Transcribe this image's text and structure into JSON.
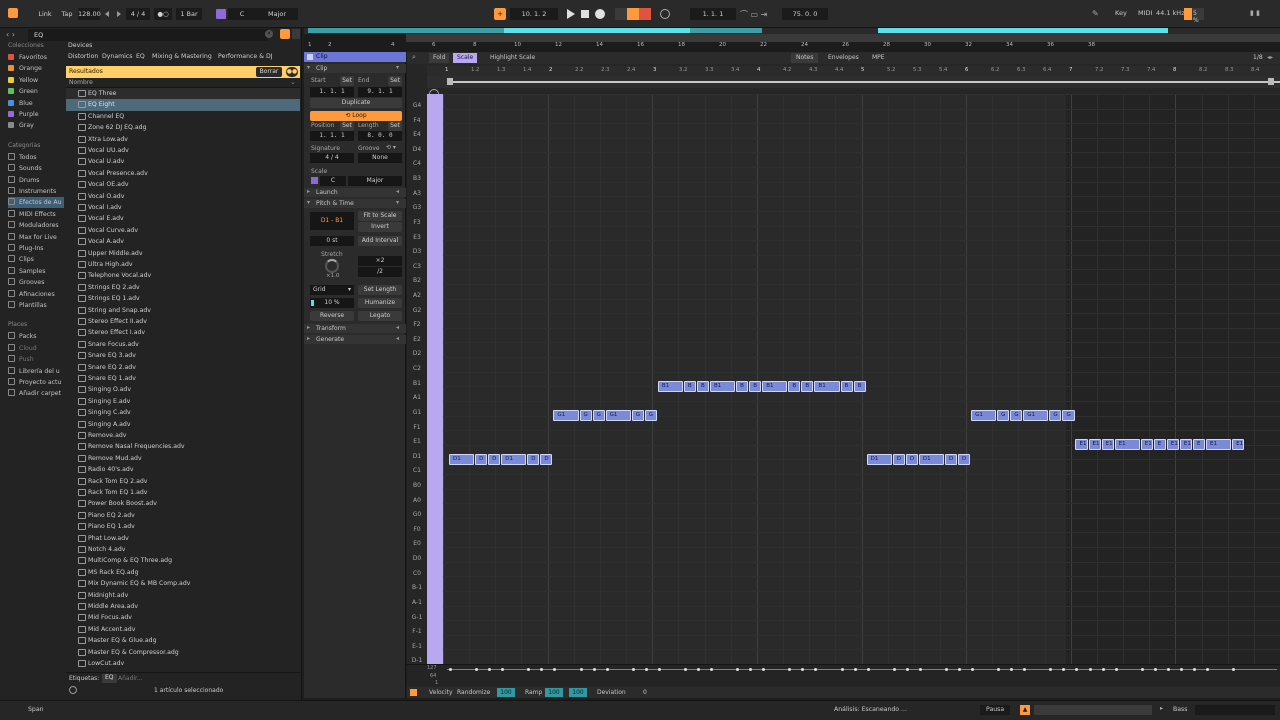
{
  "transport": {
    "link": "Link",
    "tap": "Tap",
    "tempo": "128.00",
    "sig_num": "4",
    "sig_den": "4",
    "quant": "1 Bar",
    "key": "C",
    "scale": "Major",
    "position": "10.  1.  2",
    "loop_start": "1.  1.  1",
    "loop_len": "75.  0.  0",
    "key_label": "Key",
    "midi_label": "MIDI",
    "sample_rate": "44.1 kHz",
    "cpu": "5 %"
  },
  "browser": {
    "search_value": "EQ",
    "collections_header": "Colecciones",
    "collections": [
      {
        "label": "Favoritos",
        "color": "#e0533f"
      },
      {
        "label": "Orange",
        "color": "#e8923a"
      },
      {
        "label": "Yellow",
        "color": "#e6d03a"
      },
      {
        "label": "Green",
        "color": "#5cc05c"
      },
      {
        "label": "Blue",
        "color": "#4a8fe0"
      },
      {
        "label": "Purple",
        "color": "#9a6ad6"
      },
      {
        "label": "Gray",
        "color": "#8a8a8a"
      }
    ],
    "categories_header": "Categorías",
    "categories": [
      "Todos",
      "Sounds",
      "Drums",
      "Instruments",
      "Efectos de Au",
      "MIDI Effects",
      "Moduladores",
      "Max for Live",
      "Plug-Ins",
      "Clips",
      "Samples",
      "Grooves",
      "Afinaciones",
      "Plantillas"
    ],
    "places_header": "Places",
    "places": [
      "Packs",
      "Cloud",
      "Push",
      "Librería del u",
      "Proyecto actu",
      "Añadir carpet"
    ],
    "filter_tabs": [
      "Devices",
      "Distortion",
      "Dynamics",
      "EQ",
      "Mixing & Mastering",
      "Performance & DJ"
    ],
    "results_label": "Resultados",
    "clear_label": "Borrar",
    "name_header": "Nombre",
    "files": [
      "EQ Three",
      "EQ Eight",
      "Channel EQ",
      "Zone 62 DJ EQ.adg",
      "Xtra Low.adv",
      "Vocal UU.adv",
      "Vocal U.adv",
      "Vocal Presence.adv",
      "Vocal OE.adv",
      "Vocal O.adv",
      "Vocal I.adv",
      "Vocal E.adv",
      "Vocal Curve.adv",
      "Vocal A.adv",
      "Upper Middle.adv",
      "Ultra High.adv",
      "Telephone Vocal.adv",
      "Strings EQ 2.adv",
      "Strings EQ 1.adv",
      "String and Snap.adv",
      "Stereo Effect II.adv",
      "Stereo Effect I.adv",
      "Snare Focus.adv",
      "Snare EQ 3.adv",
      "Snare EQ 2.adv",
      "Snare EQ 1.adv",
      "Singing O.adv",
      "Singing E.adv",
      "Singing C.adv",
      "Singing A.adv",
      "Remove.adv",
      "Remove Nasal Frequencies.adv",
      "Remove Mud.adv",
      "Radio 40's.adv",
      "Rack Tom EQ 2.adv",
      "Rack Tom EQ 1.adv",
      "Power Book Boost.adv",
      "Piano EQ 2.adv",
      "Piano EQ 1.adv",
      "Phat Low.adv",
      "Notch 4.adv",
      "MultiComp & EQ Three.adg",
      "MS Rack EQ.adg",
      "Mix Dynamic EQ & MB Comp.adv",
      "Midnight.adv",
      "Middle Area.adv",
      "Mid Focus.adv",
      "Mid Accent.adv",
      "Master EQ & Glue.adg",
      "Master EQ & Compressor.adg",
      "LowCut.adv"
    ],
    "tags_label": "Etiquetas:",
    "tags_value": "EQ",
    "tags_add": "Añadir...",
    "selection_status": "1 artículo seleccionado"
  },
  "clip": {
    "title": "Clip",
    "section_clip": "Clip",
    "start_label": "Start",
    "set": "Set",
    "end_label": "End",
    "start_value": "1.  1.  1",
    "end_value": "9.  1.  1",
    "duplicate": "Duplicate",
    "loop": "Loop",
    "position_label": "Position",
    "length_label": "Length",
    "position_value": "1.  1.  1",
    "length_value": "8.  0.  0",
    "signature_label": "Signature",
    "groove_label": "Groove",
    "sig_num": "4",
    "sig_den": "4",
    "groove_value": "None",
    "scale_label": "Scale",
    "scale_root": "C",
    "scale_name": "Major",
    "launch": "Launch",
    "pitch_time": "Pitch & Time",
    "range": "D1 - B1",
    "fit_to_scale": "Fit to Scale",
    "invert": "Invert",
    "transpose": "0 st",
    "add_interval": "Add Interval",
    "stretch": "Stretch",
    "stretch_value": "×1.0",
    "x2": "×2",
    "div2": "/2",
    "grid": "Grid",
    "set_length": "Set Length",
    "humanize_amount": "10 %",
    "humanize": "Humanize",
    "reverse": "Reverse",
    "legato": "Legato",
    "transform": "Transform",
    "generate": "Generate"
  },
  "editor": {
    "fold": "Fold",
    "scale_btn": "Scale",
    "highlight_scale": "Highlight Scale",
    "tabs": [
      "Notes",
      "Envelopes",
      "MPE"
    ],
    "grid_value": "1/8",
    "arrangement_ruler": [
      "1",
      "2",
      "4",
      "6",
      "8",
      "10",
      "12",
      "14",
      "16",
      "18",
      "20",
      "22",
      "24",
      "26",
      "28",
      "30",
      "32",
      "34",
      "36",
      "38"
    ],
    "clip_ruler": [
      "1",
      "1.2",
      "1.3",
      "1.4",
      "2",
      "2.2",
      "2.3",
      "2.4",
      "3",
      "3.2",
      "3.3",
      "3.4",
      "4",
      "4.2",
      "4.3",
      "4.4",
      "5",
      "5.2",
      "5.3",
      "5.4",
      "6",
      "6.2",
      "6.3",
      "6.4",
      "7",
      "7.2",
      "7.3",
      "7.4",
      "8",
      "8.2",
      "8.3",
      "8.4"
    ],
    "keys": [
      "G4",
      "F4",
      "E4",
      "D4",
      "C4",
      "B3",
      "A3",
      "G3",
      "F3",
      "E3",
      "D3",
      "C3",
      "B2",
      "A2",
      "G2",
      "F2",
      "E2",
      "D2",
      "C2",
      "B1",
      "A1",
      "G1",
      "F1",
      "E1",
      "D1",
      "C1",
      "B0",
      "A0",
      "G0",
      "F0",
      "E0",
      "D0",
      "C0",
      "B-1",
      "A-1",
      "G-1",
      "F-1",
      "E-1",
      "D-1"
    ],
    "notes": [
      {
        "key": "D1",
        "start": 0,
        "length": 0.25,
        "label": "D1"
      },
      {
        "key": "D1",
        "start": 0.25,
        "length": 0.125,
        "label": "D"
      },
      {
        "key": "D1",
        "start": 0.375,
        "length": 0.125,
        "label": "D"
      },
      {
        "key": "D1",
        "start": 0.5,
        "length": 0.25,
        "label": "D1"
      },
      {
        "key": "D1",
        "start": 0.75,
        "length": 0.125,
        "label": "D"
      },
      {
        "key": "D1",
        "start": 0.875,
        "length": 0.125,
        "label": "D"
      },
      {
        "key": "G1",
        "start": 1,
        "length": 0.25,
        "label": "G1"
      },
      {
        "key": "G1",
        "start": 1.25,
        "length": 0.125,
        "label": "G"
      },
      {
        "key": "G1",
        "start": 1.375,
        "length": 0.125,
        "label": "G"
      },
      {
        "key": "G1",
        "start": 1.5,
        "length": 0.25,
        "label": "G1"
      },
      {
        "key": "G1",
        "start": 1.75,
        "length": 0.125,
        "label": "G"
      },
      {
        "key": "G1",
        "start": 1.875,
        "length": 0.125,
        "label": "G"
      },
      {
        "key": "B1",
        "start": 2,
        "length": 0.25,
        "label": "B1"
      },
      {
        "key": "B1",
        "start": 2.25,
        "length": 0.125,
        "label": "B"
      },
      {
        "key": "B1",
        "start": 2.375,
        "length": 0.125,
        "label": "B"
      },
      {
        "key": "B1",
        "start": 2.5,
        "length": 0.25,
        "label": "B1"
      },
      {
        "key": "B1",
        "start": 2.75,
        "length": 0.125,
        "label": "B"
      },
      {
        "key": "B1",
        "start": 2.875,
        "length": 0.125,
        "label": "B"
      },
      {
        "key": "B1",
        "start": 3,
        "length": 0.25,
        "label": "B1"
      },
      {
        "key": "B1",
        "start": 3.25,
        "length": 0.125,
        "label": "B"
      },
      {
        "key": "B1",
        "start": 3.375,
        "length": 0.125,
        "label": "B"
      },
      {
        "key": "B1",
        "start": 3.5,
        "length": 0.25,
        "label": "B1"
      },
      {
        "key": "B1",
        "start": 3.75,
        "length": 0.125,
        "label": "B"
      },
      {
        "key": "B1",
        "start": 3.875,
        "length": 0.125,
        "label": "B"
      },
      {
        "key": "D1",
        "start": 4,
        "length": 0.25,
        "label": "D1"
      },
      {
        "key": "D1",
        "start": 4.25,
        "length": 0.125,
        "label": "D"
      },
      {
        "key": "D1",
        "start": 4.375,
        "length": 0.125,
        "label": "D"
      },
      {
        "key": "D1",
        "start": 4.5,
        "length": 0.25,
        "label": "D1"
      },
      {
        "key": "D1",
        "start": 4.75,
        "length": 0.125,
        "label": "D"
      },
      {
        "key": "D1",
        "start": 4.875,
        "length": 0.125,
        "label": "D"
      },
      {
        "key": "G1",
        "start": 5,
        "length": 0.25,
        "label": "G1"
      },
      {
        "key": "G1",
        "start": 5.25,
        "length": 0.125,
        "label": "G"
      },
      {
        "key": "G1",
        "start": 5.375,
        "length": 0.125,
        "label": "G"
      },
      {
        "key": "G1",
        "start": 5.5,
        "length": 0.25,
        "label": "G1"
      },
      {
        "key": "G1",
        "start": 5.75,
        "length": 0.125,
        "label": "G"
      },
      {
        "key": "G1",
        "start": 5.875,
        "length": 0.125,
        "label": "G"
      },
      {
        "key": "E1",
        "start": 6,
        "length": 0.125,
        "label": "E1"
      },
      {
        "key": "E1",
        "start": 6.125,
        "length": 0.125,
        "label": "E1"
      },
      {
        "key": "E1",
        "start": 6.25,
        "length": 0.125,
        "label": "E1"
      },
      {
        "key": "E1",
        "start": 6.375,
        "length": 0.25,
        "label": "E1"
      },
      {
        "key": "E1",
        "start": 6.625,
        "length": 0.125,
        "label": "E1"
      },
      {
        "key": "E1",
        "start": 6.75,
        "length": 0.125,
        "label": "E"
      },
      {
        "key": "E1",
        "start": 6.875,
        "length": 0.125,
        "label": "E1"
      },
      {
        "key": "E1",
        "start": 7,
        "length": 0.125,
        "label": "E1"
      },
      {
        "key": "E1",
        "start": 7.125,
        "length": 0.125,
        "label": "E"
      },
      {
        "key": "E1",
        "start": 7.25,
        "length": 0.25,
        "label": "E1"
      },
      {
        "key": "E1",
        "start": 7.5,
        "length": 0.125,
        "label": "E1"
      }
    ],
    "velocity_max": "127",
    "velocity_mid": "64",
    "velocity_min": "1",
    "velocity_label": "Velocity",
    "randomize": "Randomize",
    "randomize_value": "100",
    "ramp": "Ramp",
    "ramp_value": "100",
    "deviation": "Deviation",
    "deviation_value": "0"
  },
  "status": {
    "left": "Span",
    "analysis": "Análisis: Escaneando ...",
    "pause": "Pausa",
    "track": "Bass"
  },
  "colors": {
    "accent": "#ff9a3c",
    "cyan": "#5fe0e8",
    "note": "#7a8ad6",
    "purple_key": "#b7a8f0"
  }
}
